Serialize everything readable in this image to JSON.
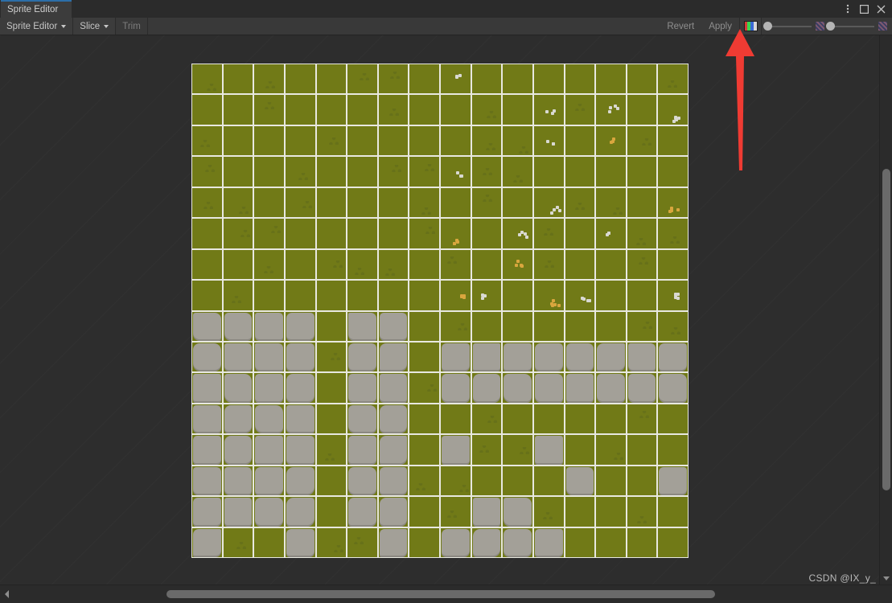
{
  "window": {
    "tab_label": "Sprite Editor",
    "accent_color": "#2c6ea8",
    "controls": [
      {
        "name": "more-options",
        "glyph": "kebab"
      },
      {
        "name": "maximize",
        "glyph": "square"
      },
      {
        "name": "close",
        "glyph": "x"
      }
    ]
  },
  "toolbar": {
    "sprite_editor_label": "Sprite Editor",
    "slice_label": "Slice",
    "trim_label": "Trim",
    "revert_label": "Revert",
    "apply_label": "Apply",
    "channel_icon_name": "rgb-channel-icon",
    "channel_colors": [
      "#d53a3a",
      "#3ad54f",
      "#3a6ad5",
      "#d8d8d8"
    ],
    "sliders": [
      {
        "name": "alpha-slider",
        "value_pct": 0,
        "end_icon": "checker-icon"
      },
      {
        "name": "zoom-slider",
        "value_pct": 0,
        "end_icon": "checker-icon"
      }
    ]
  },
  "canvas": {
    "background_color": "#2d2d2d",
    "grass_color": "#717a17",
    "stone_color": "#a3a098",
    "grid_line_color": "#e8e8e0",
    "columns": 16,
    "rows": 16,
    "stone_rows": [
      [
        1,
        1,
        1,
        1,
        0,
        1,
        1,
        0,
        0,
        0,
        0,
        0,
        0,
        0,
        0,
        0
      ],
      [
        1,
        1,
        1,
        1,
        0,
        1,
        1,
        0,
        1,
        1,
        1,
        1,
        1,
        1,
        1,
        1
      ],
      [
        1,
        1,
        1,
        1,
        0,
        1,
        1,
        0,
        1,
        1,
        1,
        1,
        1,
        1,
        1,
        1
      ],
      [
        1,
        1,
        1,
        1,
        0,
        1,
        1,
        0,
        0,
        0,
        0,
        0,
        0,
        0,
        0,
        0
      ],
      [
        1,
        1,
        1,
        1,
        0,
        1,
        1,
        0,
        1,
        0,
        0,
        1,
        0,
        0,
        0,
        0
      ],
      [
        1,
        1,
        1,
        1,
        0,
        1,
        1,
        0,
        0,
        0,
        0,
        0,
        1,
        0,
        0,
        1
      ],
      [
        1,
        1,
        1,
        1,
        0,
        1,
        1,
        0,
        0,
        1,
        1,
        0,
        0,
        0,
        0,
        0
      ],
      [
        1,
        0,
        0,
        1,
        0,
        0,
        1,
        0,
        1,
        1,
        1,
        1,
        0,
        0,
        0,
        0
      ]
    ],
    "decor": [
      {
        "type": "tuft",
        "col": 2,
        "row": 0
      },
      {
        "type": "tuft",
        "col": 12,
        "row": 1
      },
      {
        "type": "pebble-white",
        "col": 8,
        "row": 0
      },
      {
        "type": "pebble-white",
        "col": 11,
        "row": 1
      },
      {
        "type": "pebble-white",
        "col": 13,
        "row": 1
      },
      {
        "type": "pebble-white",
        "col": 15,
        "row": 1
      },
      {
        "type": "tuft",
        "col": 4,
        "row": 2
      },
      {
        "type": "pebble-white",
        "col": 8,
        "row": 3
      },
      {
        "type": "pebble-white",
        "col": 11,
        "row": 2
      },
      {
        "type": "pebble-orange",
        "col": 13,
        "row": 2
      },
      {
        "type": "tuft",
        "col": 0,
        "row": 3
      },
      {
        "type": "tuft",
        "col": 7,
        "row": 3
      },
      {
        "type": "tuft",
        "col": 1,
        "row": 4
      },
      {
        "type": "pebble-white",
        "col": 11,
        "row": 4
      },
      {
        "type": "pebble-orange",
        "col": 15,
        "row": 4
      },
      {
        "type": "pebble-orange",
        "col": 8,
        "row": 5
      },
      {
        "type": "pebble-white",
        "col": 10,
        "row": 5
      },
      {
        "type": "pebble-white",
        "col": 13,
        "row": 5
      },
      {
        "type": "pebble-orange",
        "col": 10,
        "row": 6
      },
      {
        "type": "pebble-orange",
        "col": 11,
        "row": 7
      },
      {
        "type": "pebble-white",
        "col": 9,
        "row": 7
      },
      {
        "type": "pebble-white",
        "col": 12,
        "row": 7
      },
      {
        "type": "pebble-white",
        "col": 15,
        "row": 7
      },
      {
        "type": "pebble-orange",
        "col": 8,
        "row": 7
      }
    ]
  },
  "scrollbars": {
    "vertical": {
      "name": "vertical-scrollbar",
      "thumb_top_pct": 24,
      "thumb_height_pct": 59
    },
    "horizontal": {
      "name": "horizontal-scrollbar",
      "thumb_left_pct": 19,
      "thumb_width_pct": 61
    }
  },
  "annotation": {
    "arrow_color": "#ef3b33",
    "points_to": "Apply"
  },
  "watermark": {
    "text": "CSDN @IX_y_"
  }
}
